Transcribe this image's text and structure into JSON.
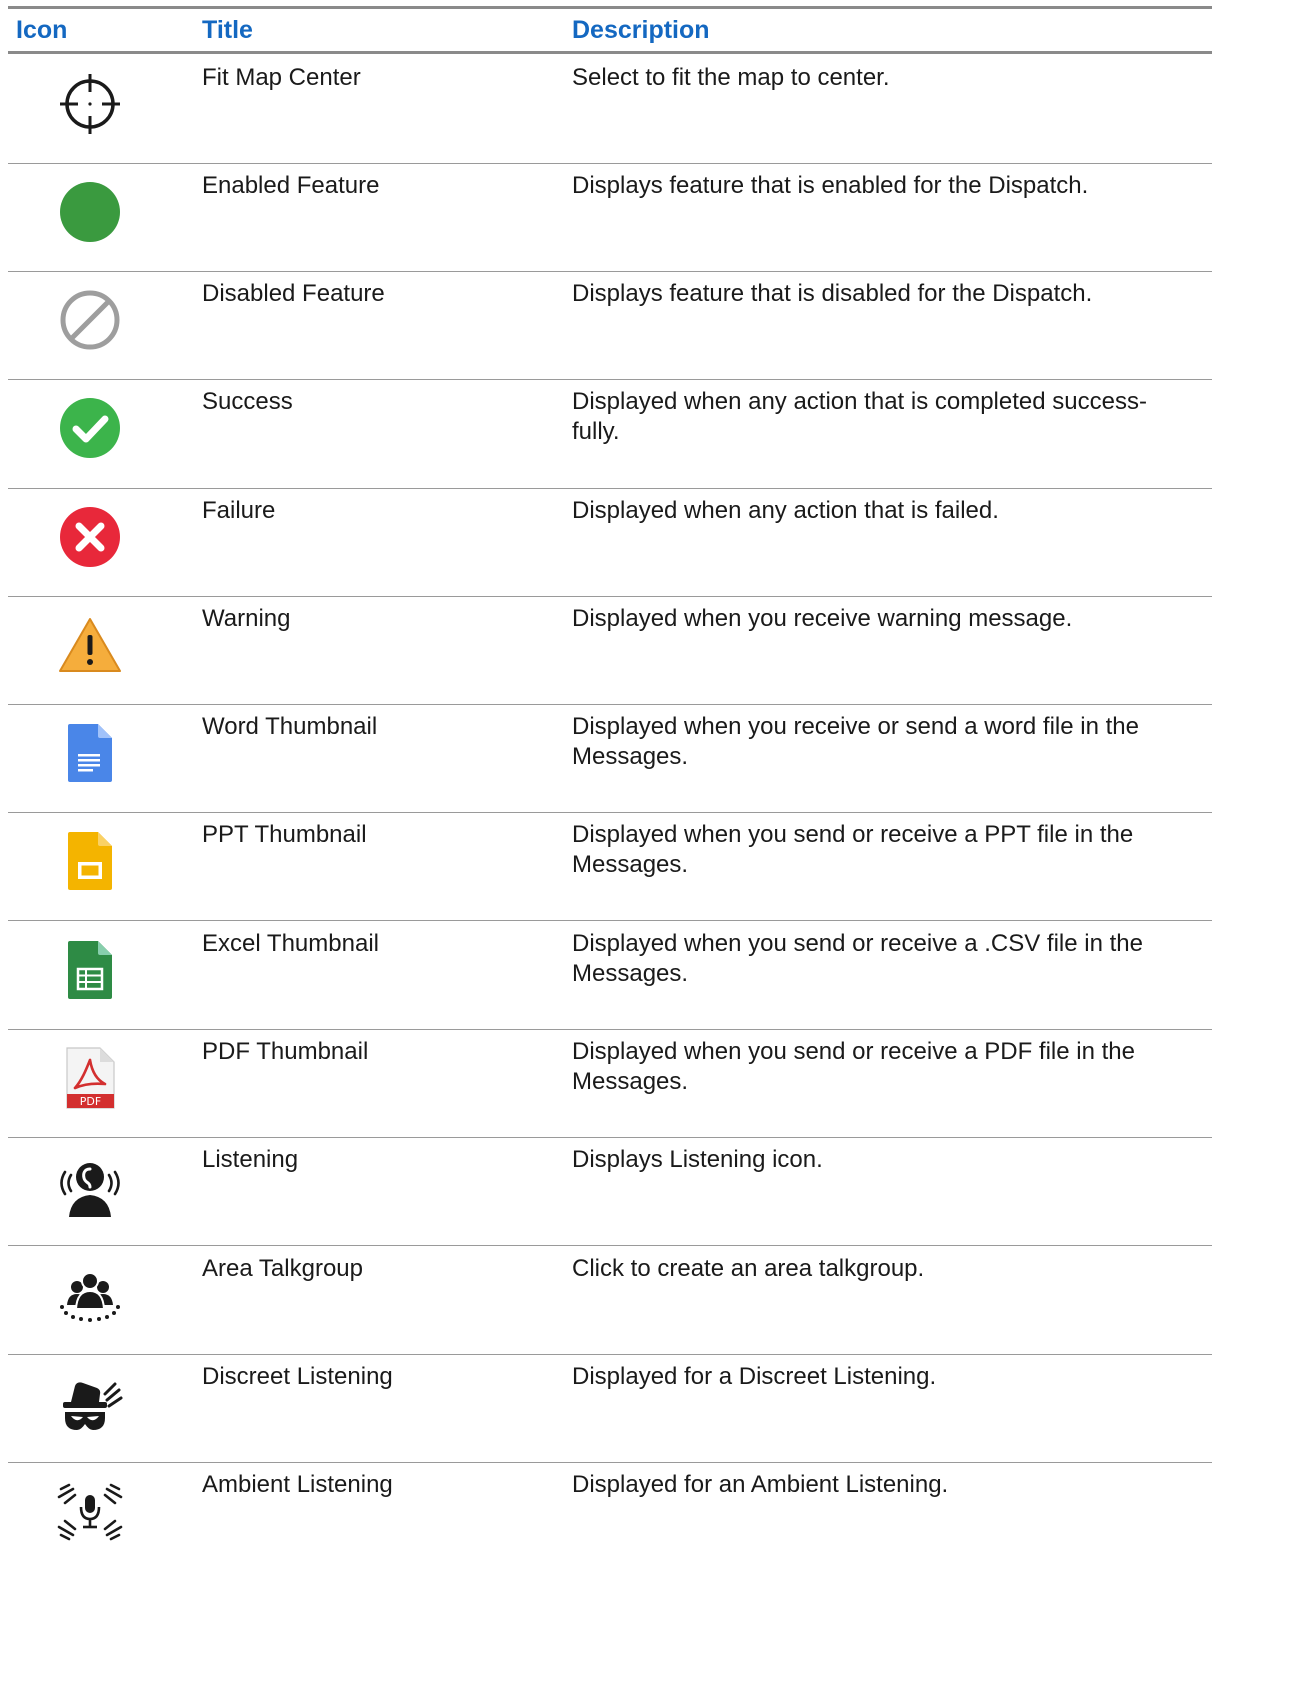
{
  "header": {
    "icon_col": "Icon",
    "title_col": "Title",
    "description_col": "Description"
  },
  "rows": [
    {
      "icon": "crosshair-icon",
      "title": "Fit Map Center",
      "description": "Select to fit the map to center."
    },
    {
      "icon": "green-dot-icon",
      "title": "Enabled Feature",
      "description": "Displays feature that is enabled for the Dispatch."
    },
    {
      "icon": "disabled-circle-icon",
      "title": "Disabled Feature",
      "description": "Displays feature that is disabled for the Dispatch."
    },
    {
      "icon": "success-check-icon",
      "title": "Success",
      "description": "Displayed when any action that is completed success-fully."
    },
    {
      "icon": "failure-x-icon",
      "title": "Failure",
      "description": "Displayed when any action that is failed."
    },
    {
      "icon": "warning-triangle-icon",
      "title": "Warning",
      "description": "Displayed when you receive warning message."
    },
    {
      "icon": "word-file-icon",
      "title": "Word Thumbnail",
      "description": "Displayed when you receive or send a word file in the Messages."
    },
    {
      "icon": "ppt-file-icon",
      "title": "PPT Thumbnail",
      "description": "Displayed when you send or receive a PPT file in the Messages."
    },
    {
      "icon": "excel-file-icon",
      "title": "Excel Thumbnail",
      "description": "Displayed when you send or receive a .CSV file in the Messages."
    },
    {
      "icon": "pdf-file-icon",
      "title": "PDF Thumbnail",
      "description": "Displayed when you send or receive a PDF file in the Messages."
    },
    {
      "icon": "listening-icon",
      "title": "Listening",
      "description": "Displays Listening icon."
    },
    {
      "icon": "area-talkgroup-icon",
      "title": "Area Talkgroup",
      "description": "Click to create an area talkgroup."
    },
    {
      "icon": "discreet-listening-icon",
      "title": "Discreet Listening",
      "description": "Displayed for a Discreet Listening."
    },
    {
      "icon": "ambient-listening-icon",
      "title": "Ambient Listening",
      "description": "Displayed for an Ambient Listening."
    }
  ],
  "pdf_label": "PDF",
  "colors": {
    "header_text": "#1468c1",
    "enabled": "#3a9a3f",
    "success": "#3cb44b",
    "failure": "#e8283a",
    "warning": "#f5ad3c",
    "word": "#4a86e8",
    "ppt": "#f4b400",
    "excel": "#2e8b45",
    "pdf": "#d32f2f"
  }
}
